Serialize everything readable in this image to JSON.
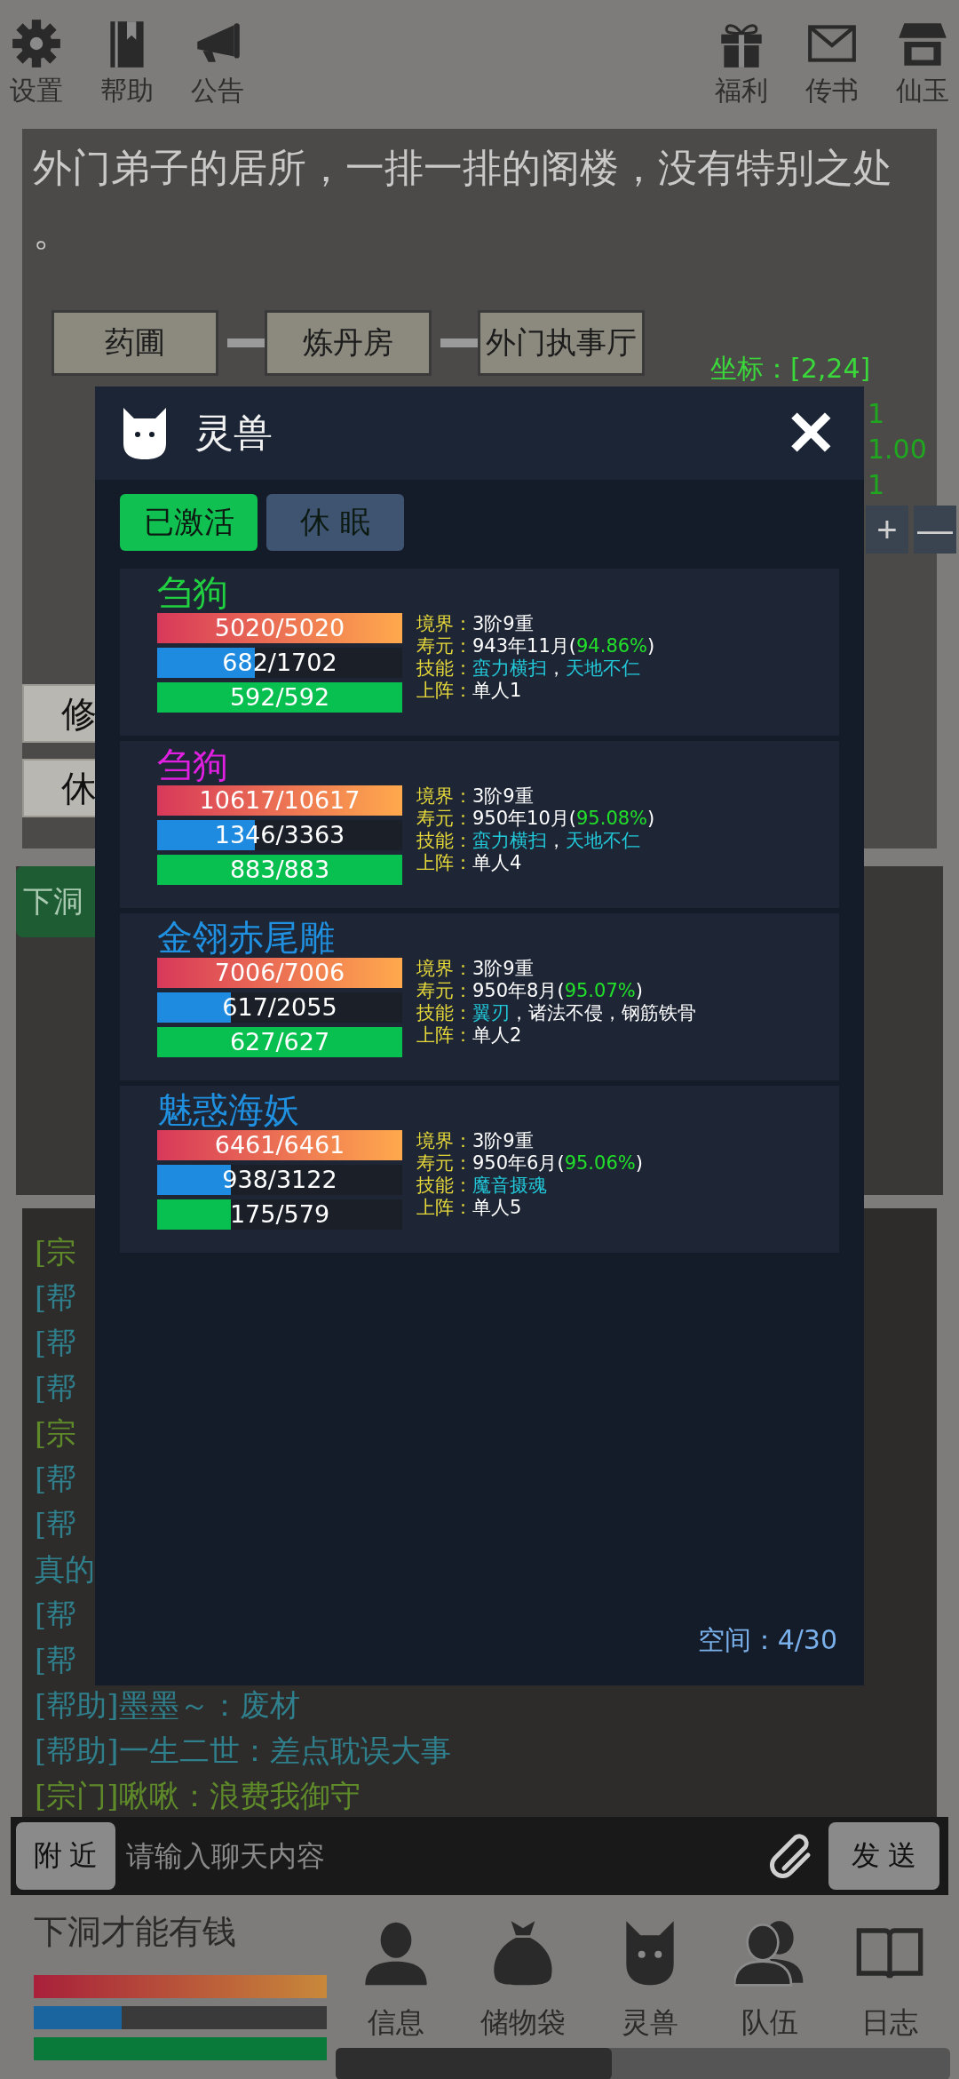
{
  "top_bar": {
    "left": [
      {
        "label": "设置"
      },
      {
        "label": "帮助"
      },
      {
        "label": "公告"
      }
    ],
    "right": [
      {
        "label": "福利"
      },
      {
        "label": "传书"
      },
      {
        "label": "仙玉"
      }
    ]
  },
  "location": {
    "description": "外门弟子的居所，一排一排的阁楼，没有特别之处。",
    "map_nodes": [
      "药圃",
      "炼丹房",
      "外门执事厅"
    ],
    "coordinates": "坐标：[2,24]",
    "side_readings": [
      "1",
      "1.00",
      "1"
    ],
    "zoom_buttons": [
      "+",
      "—"
    ],
    "actions": [
      "修",
      "休"
    ]
  },
  "dungeon_button": "下洞",
  "chat": {
    "lines": [
      {
        "kind": "sect",
        "text": "[宗"
      },
      {
        "kind": "help",
        "text": "[帮"
      },
      {
        "kind": "help",
        "text": "[帮"
      },
      {
        "kind": "help",
        "text": "[帮"
      },
      {
        "kind": "sect",
        "text": "[宗"
      },
      {
        "kind": "help",
        "text": "[帮"
      },
      {
        "kind": "help",
        "text": "[帮"
      },
      {
        "kind": "help",
        "text": "真的"
      },
      {
        "kind": "help",
        "text": "[帮"
      },
      {
        "kind": "help",
        "text": "[帮"
      },
      {
        "kind": "help",
        "text": "[帮助]墨墨～：废材"
      },
      {
        "kind": "help",
        "text": "[帮助]一生二世：差点耽误大事"
      },
      {
        "kind": "sect",
        "text": "[宗门]啾啾：浪费我御守"
      }
    ],
    "channel_button": "附 近",
    "placeholder": "请输入聊天内容",
    "send_button": "发 送"
  },
  "player": {
    "name": "下洞才能有钱",
    "bars": [
      {
        "kind": "hp",
        "level": 1
      },
      {
        "kind": "mp",
        "level": 0.3
      },
      {
        "kind": "sp",
        "level": 1
      }
    ]
  },
  "nav": [
    {
      "label": "信息"
    },
    {
      "label": "储物袋"
    },
    {
      "label": "灵兽"
    },
    {
      "label": "队伍"
    },
    {
      "label": "日志"
    }
  ],
  "modal": {
    "title": "灵兽",
    "close": "✕",
    "tabs": [
      {
        "label": "已激活",
        "selected": true
      },
      {
        "label": "休 眠",
        "selected": false
      }
    ],
    "pets": [
      {
        "name": "刍狗",
        "color": "#20d040",
        "bars": [
          {
            "kind": "hp",
            "level": 1,
            "text": "5020/5020"
          },
          {
            "kind": "mp",
            "level": 0.4,
            "text": "682/1702"
          },
          {
            "kind": "sp",
            "level": 1,
            "text": "592/592"
          }
        ],
        "fields": [
          {
            "label": "境界：",
            "segments": [
              {
                "text": "3阶9重",
                "color": "#ffffff"
              }
            ]
          },
          {
            "label": "寿元：",
            "segments": [
              {
                "text": "943年11月(",
                "color": "#ffffff"
              },
              {
                "text": "94.86%",
                "color": "#22e02a"
              },
              {
                "text": ")",
                "color": "#ffffff"
              }
            ]
          },
          {
            "label": "技能：",
            "segments": [
              {
                "text": "蛮力横扫",
                "color": "#22c8d8"
              },
              {
                "text": "，"
              },
              {
                "text": "天地不仁",
                "color": "#22c8d8"
              }
            ]
          },
          {
            "label": "上阵：",
            "segments": [
              {
                "text": "单人1",
                "color": "#ffffff"
              }
            ]
          }
        ]
      },
      {
        "name": "刍狗",
        "color": "#e020e0",
        "bars": [
          {
            "kind": "hp",
            "level": 1,
            "text": "10617/10617"
          },
          {
            "kind": "mp",
            "level": 0.4,
            "text": "1346/3363"
          },
          {
            "kind": "sp",
            "level": 1,
            "text": "883/883"
          }
        ],
        "fields": [
          {
            "label": "境界：",
            "segments": [
              {
                "text": "3阶9重",
                "color": "#ffffff"
              }
            ]
          },
          {
            "label": "寿元：",
            "segments": [
              {
                "text": "950年10月(",
                "color": "#ffffff"
              },
              {
                "text": "95.08%",
                "color": "#22e02a"
              },
              {
                "text": ")",
                "color": "#ffffff"
              }
            ]
          },
          {
            "label": "技能：",
            "segments": [
              {
                "text": "蛮力横扫",
                "color": "#22c8d8"
              },
              {
                "text": "，"
              },
              {
                "text": "天地不仁",
                "color": "#22c8d8"
              }
            ]
          },
          {
            "label": "上阵：",
            "segments": [
              {
                "text": "单人4",
                "color": "#ffffff"
              }
            ]
          }
        ]
      },
      {
        "name": "金翎赤尾雕",
        "color": "#2090e0",
        "bars": [
          {
            "kind": "hp",
            "level": 1,
            "text": "7006/7006"
          },
          {
            "kind": "mp",
            "level": 0.3,
            "text": "617/2055"
          },
          {
            "kind": "sp",
            "level": 1,
            "text": "627/627"
          }
        ],
        "fields": [
          {
            "label": "境界：",
            "segments": [
              {
                "text": "3阶9重",
                "color": "#ffffff"
              }
            ]
          },
          {
            "label": "寿元：",
            "segments": [
              {
                "text": "950年8月(",
                "color": "#ffffff"
              },
              {
                "text": "95.07%",
                "color": "#22e02a"
              },
              {
                "text": ")",
                "color": "#ffffff"
              }
            ]
          },
          {
            "label": "技能：",
            "segments": [
              {
                "text": "翼刃",
                "color": "#22c8d8"
              },
              {
                "text": "，诸法不侵，钢筋铁骨",
                "color": "#ffffff"
              }
            ]
          },
          {
            "label": "上阵：",
            "segments": [
              {
                "text": "单人2",
                "color": "#ffffff"
              }
            ]
          }
        ]
      },
      {
        "name": "魅惑海妖",
        "color": "#2090e0",
        "bars": [
          {
            "kind": "hp",
            "level": 1,
            "text": "6461/6461"
          },
          {
            "kind": "mp",
            "level": 0.3,
            "text": "938/3122"
          },
          {
            "kind": "sp",
            "level": 0.3,
            "text": "175/579"
          }
        ],
        "fields": [
          {
            "label": "境界：",
            "segments": [
              {
                "text": "3阶9重",
                "color": "#ffffff"
              }
            ]
          },
          {
            "label": "寿元：",
            "segments": [
              {
                "text": "950年6月(",
                "color": "#ffffff"
              },
              {
                "text": "95.06%",
                "color": "#22e02a"
              },
              {
                "text": ")",
                "color": "#ffffff"
              }
            ]
          },
          {
            "label": "技能：",
            "segments": [
              {
                "text": "魔音摄魂",
                "color": "#22c8d8"
              }
            ]
          },
          {
            "label": "上阵：",
            "segments": [
              {
                "text": "单人5",
                "color": "#ffffff"
              }
            ]
          }
        ]
      }
    ],
    "capacity": "空间：4/30"
  }
}
